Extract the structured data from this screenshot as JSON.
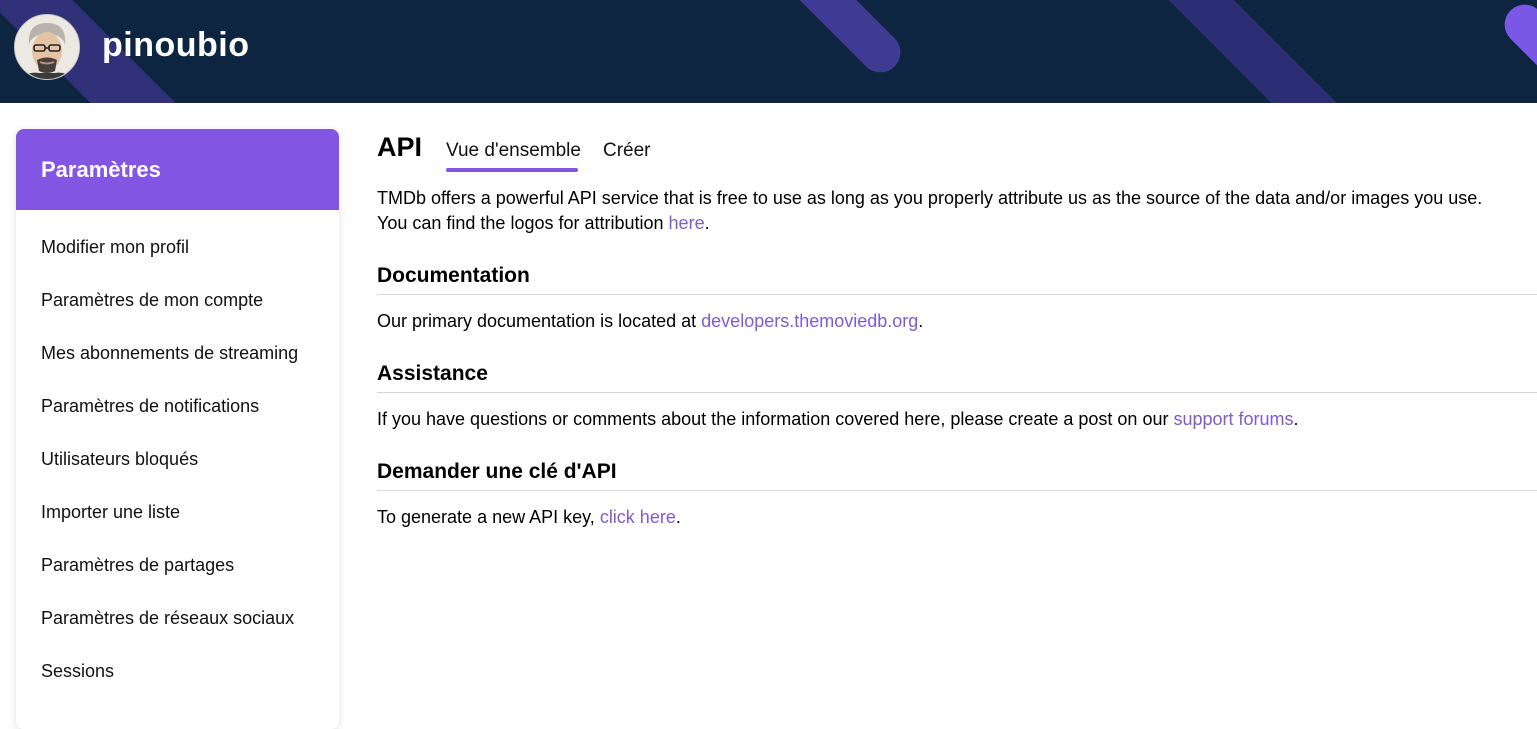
{
  "header": {
    "username": "pinoubio"
  },
  "sidebar": {
    "title": "Paramètres",
    "items": [
      {
        "label": "Modifier mon profil"
      },
      {
        "label": "Paramètres de mon compte"
      },
      {
        "label": "Mes abonnements de streaming"
      },
      {
        "label": "Paramètres de notifications"
      },
      {
        "label": "Utilisateurs bloqués"
      },
      {
        "label": "Importer une liste"
      },
      {
        "label": "Paramètres de partages"
      },
      {
        "label": "Paramètres de réseaux sociaux"
      },
      {
        "label": "Sessions"
      }
    ]
  },
  "main": {
    "title": "API",
    "tabs": [
      {
        "label": "Vue d'ensemble",
        "active": true
      },
      {
        "label": "Créer",
        "active": false
      }
    ],
    "intro": {
      "text_1": "TMDb offers a powerful API service that is free to use as long as you properly attribute us as the source of the data and/or images you use.",
      "text_2": "You can find the logos for attribution ",
      "link": "here",
      "after": "."
    },
    "documentation": {
      "heading": "Documentation",
      "text": "Our primary documentation is located at ",
      "link": "developers.themoviedb.org",
      "after": "."
    },
    "assistance": {
      "heading": "Assistance",
      "text": "If you have questions or comments about the information covered here, please create a post on our ",
      "link": "support forums",
      "after": "."
    },
    "request_key": {
      "heading": "Demander une clé d'API",
      "text": "To generate a new API key, ",
      "link": "click here",
      "after": "."
    }
  },
  "colors": {
    "header_bg": "#0d2541",
    "accent": "#8355e3",
    "link": "#7e5bd0"
  }
}
